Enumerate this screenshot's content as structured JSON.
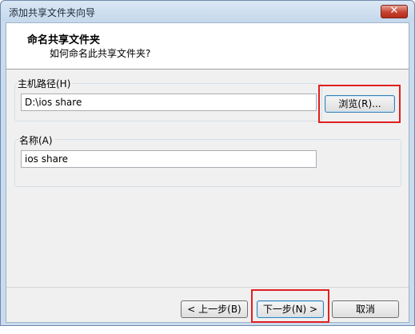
{
  "window": {
    "title": "添加共享文件夹向导",
    "close_symbol": "✕"
  },
  "header": {
    "title": "命名共享文件夹",
    "subtitle": "如何命名此共享文件夹?"
  },
  "host_path": {
    "label": "主机路径(H)",
    "value": "D:\\ios share",
    "browse_label": "浏览(R)..."
  },
  "name": {
    "label": "名称(A)",
    "value": "ios share"
  },
  "buttons": {
    "back_label": "< 上一步(B)",
    "next_label": "下一步(N) >",
    "cancel_label": "取消"
  },
  "colors": {
    "highlight": "#e02020",
    "close_button": "#c6422f"
  }
}
